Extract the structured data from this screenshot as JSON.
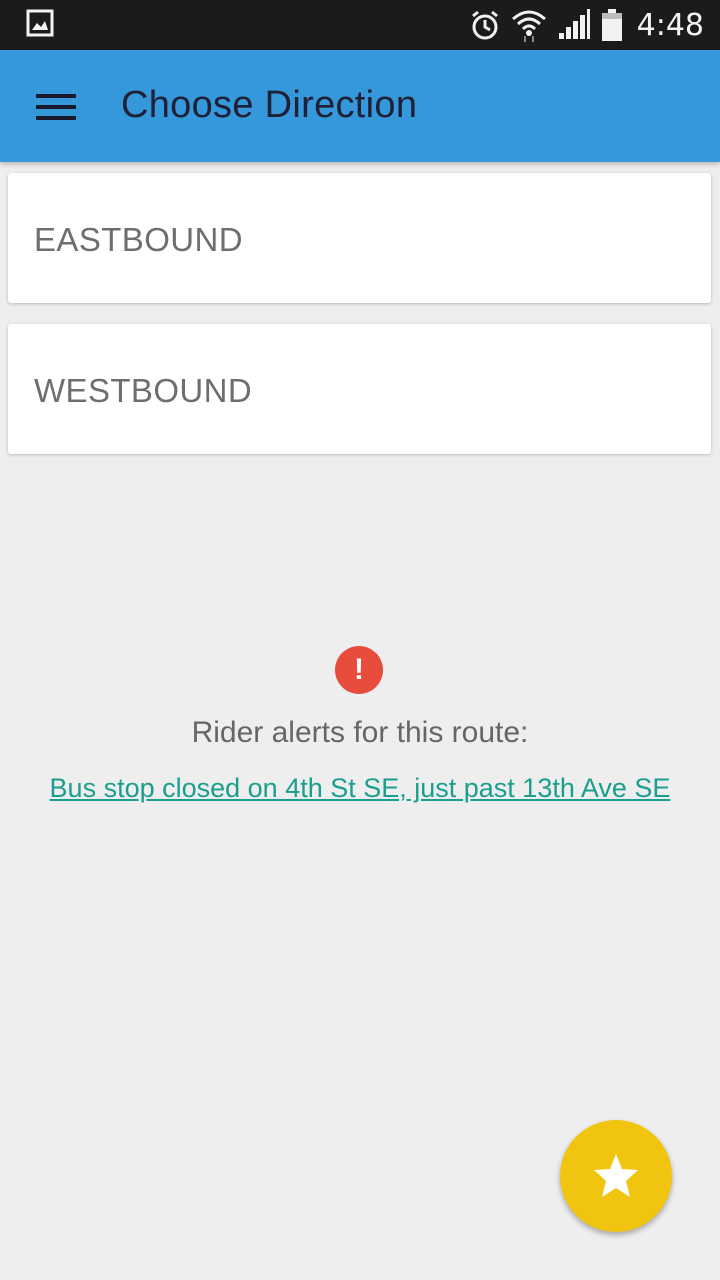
{
  "status_bar": {
    "left_icon": "image-icon",
    "right_icons": [
      "alarm-icon",
      "wifi-icon",
      "signal-icon",
      "battery-icon"
    ],
    "time": "4:48"
  },
  "app_bar": {
    "menu_icon": "menu-icon",
    "title": "Choose Direction",
    "color": "#3498db"
  },
  "directions": [
    {
      "label": "EASTBOUND"
    },
    {
      "label": "WESTBOUND"
    }
  ],
  "alerts": {
    "icon": "alert-icon",
    "icon_glyph": "!",
    "icon_color": "#e74c3c",
    "heading": "Rider alerts for this route:",
    "link_text": "Bus stop closed on 4th St SE, just past 13th Ave SE",
    "link_color": "#1a9f8f"
  },
  "fab": {
    "icon": "star-icon",
    "color": "#f1c40f"
  }
}
